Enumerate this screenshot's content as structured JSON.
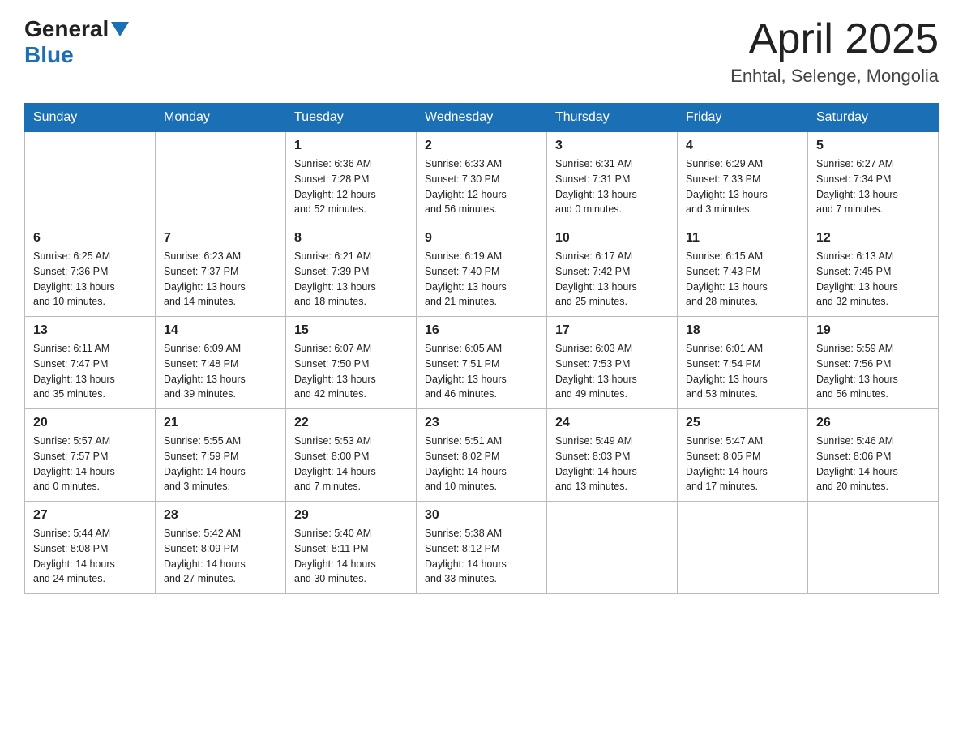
{
  "header": {
    "logo_general": "General",
    "logo_blue": "Blue",
    "title_month": "April 2025",
    "title_location": "Enhtal, Selenge, Mongolia"
  },
  "calendar": {
    "days_of_week": [
      "Sunday",
      "Monday",
      "Tuesday",
      "Wednesday",
      "Thursday",
      "Friday",
      "Saturday"
    ],
    "weeks": [
      [
        {
          "day": "",
          "info": ""
        },
        {
          "day": "",
          "info": ""
        },
        {
          "day": "1",
          "info": "Sunrise: 6:36 AM\nSunset: 7:28 PM\nDaylight: 12 hours\nand 52 minutes."
        },
        {
          "day": "2",
          "info": "Sunrise: 6:33 AM\nSunset: 7:30 PM\nDaylight: 12 hours\nand 56 minutes."
        },
        {
          "day": "3",
          "info": "Sunrise: 6:31 AM\nSunset: 7:31 PM\nDaylight: 13 hours\nand 0 minutes."
        },
        {
          "day": "4",
          "info": "Sunrise: 6:29 AM\nSunset: 7:33 PM\nDaylight: 13 hours\nand 3 minutes."
        },
        {
          "day": "5",
          "info": "Sunrise: 6:27 AM\nSunset: 7:34 PM\nDaylight: 13 hours\nand 7 minutes."
        }
      ],
      [
        {
          "day": "6",
          "info": "Sunrise: 6:25 AM\nSunset: 7:36 PM\nDaylight: 13 hours\nand 10 minutes."
        },
        {
          "day": "7",
          "info": "Sunrise: 6:23 AM\nSunset: 7:37 PM\nDaylight: 13 hours\nand 14 minutes."
        },
        {
          "day": "8",
          "info": "Sunrise: 6:21 AM\nSunset: 7:39 PM\nDaylight: 13 hours\nand 18 minutes."
        },
        {
          "day": "9",
          "info": "Sunrise: 6:19 AM\nSunset: 7:40 PM\nDaylight: 13 hours\nand 21 minutes."
        },
        {
          "day": "10",
          "info": "Sunrise: 6:17 AM\nSunset: 7:42 PM\nDaylight: 13 hours\nand 25 minutes."
        },
        {
          "day": "11",
          "info": "Sunrise: 6:15 AM\nSunset: 7:43 PM\nDaylight: 13 hours\nand 28 minutes."
        },
        {
          "day": "12",
          "info": "Sunrise: 6:13 AM\nSunset: 7:45 PM\nDaylight: 13 hours\nand 32 minutes."
        }
      ],
      [
        {
          "day": "13",
          "info": "Sunrise: 6:11 AM\nSunset: 7:47 PM\nDaylight: 13 hours\nand 35 minutes."
        },
        {
          "day": "14",
          "info": "Sunrise: 6:09 AM\nSunset: 7:48 PM\nDaylight: 13 hours\nand 39 minutes."
        },
        {
          "day": "15",
          "info": "Sunrise: 6:07 AM\nSunset: 7:50 PM\nDaylight: 13 hours\nand 42 minutes."
        },
        {
          "day": "16",
          "info": "Sunrise: 6:05 AM\nSunset: 7:51 PM\nDaylight: 13 hours\nand 46 minutes."
        },
        {
          "day": "17",
          "info": "Sunrise: 6:03 AM\nSunset: 7:53 PM\nDaylight: 13 hours\nand 49 minutes."
        },
        {
          "day": "18",
          "info": "Sunrise: 6:01 AM\nSunset: 7:54 PM\nDaylight: 13 hours\nand 53 minutes."
        },
        {
          "day": "19",
          "info": "Sunrise: 5:59 AM\nSunset: 7:56 PM\nDaylight: 13 hours\nand 56 minutes."
        }
      ],
      [
        {
          "day": "20",
          "info": "Sunrise: 5:57 AM\nSunset: 7:57 PM\nDaylight: 14 hours\nand 0 minutes."
        },
        {
          "day": "21",
          "info": "Sunrise: 5:55 AM\nSunset: 7:59 PM\nDaylight: 14 hours\nand 3 minutes."
        },
        {
          "day": "22",
          "info": "Sunrise: 5:53 AM\nSunset: 8:00 PM\nDaylight: 14 hours\nand 7 minutes."
        },
        {
          "day": "23",
          "info": "Sunrise: 5:51 AM\nSunset: 8:02 PM\nDaylight: 14 hours\nand 10 minutes."
        },
        {
          "day": "24",
          "info": "Sunrise: 5:49 AM\nSunset: 8:03 PM\nDaylight: 14 hours\nand 13 minutes."
        },
        {
          "day": "25",
          "info": "Sunrise: 5:47 AM\nSunset: 8:05 PM\nDaylight: 14 hours\nand 17 minutes."
        },
        {
          "day": "26",
          "info": "Sunrise: 5:46 AM\nSunset: 8:06 PM\nDaylight: 14 hours\nand 20 minutes."
        }
      ],
      [
        {
          "day": "27",
          "info": "Sunrise: 5:44 AM\nSunset: 8:08 PM\nDaylight: 14 hours\nand 24 minutes."
        },
        {
          "day": "28",
          "info": "Sunrise: 5:42 AM\nSunset: 8:09 PM\nDaylight: 14 hours\nand 27 minutes."
        },
        {
          "day": "29",
          "info": "Sunrise: 5:40 AM\nSunset: 8:11 PM\nDaylight: 14 hours\nand 30 minutes."
        },
        {
          "day": "30",
          "info": "Sunrise: 5:38 AM\nSunset: 8:12 PM\nDaylight: 14 hours\nand 33 minutes."
        },
        {
          "day": "",
          "info": ""
        },
        {
          "day": "",
          "info": ""
        },
        {
          "day": "",
          "info": ""
        }
      ]
    ]
  }
}
